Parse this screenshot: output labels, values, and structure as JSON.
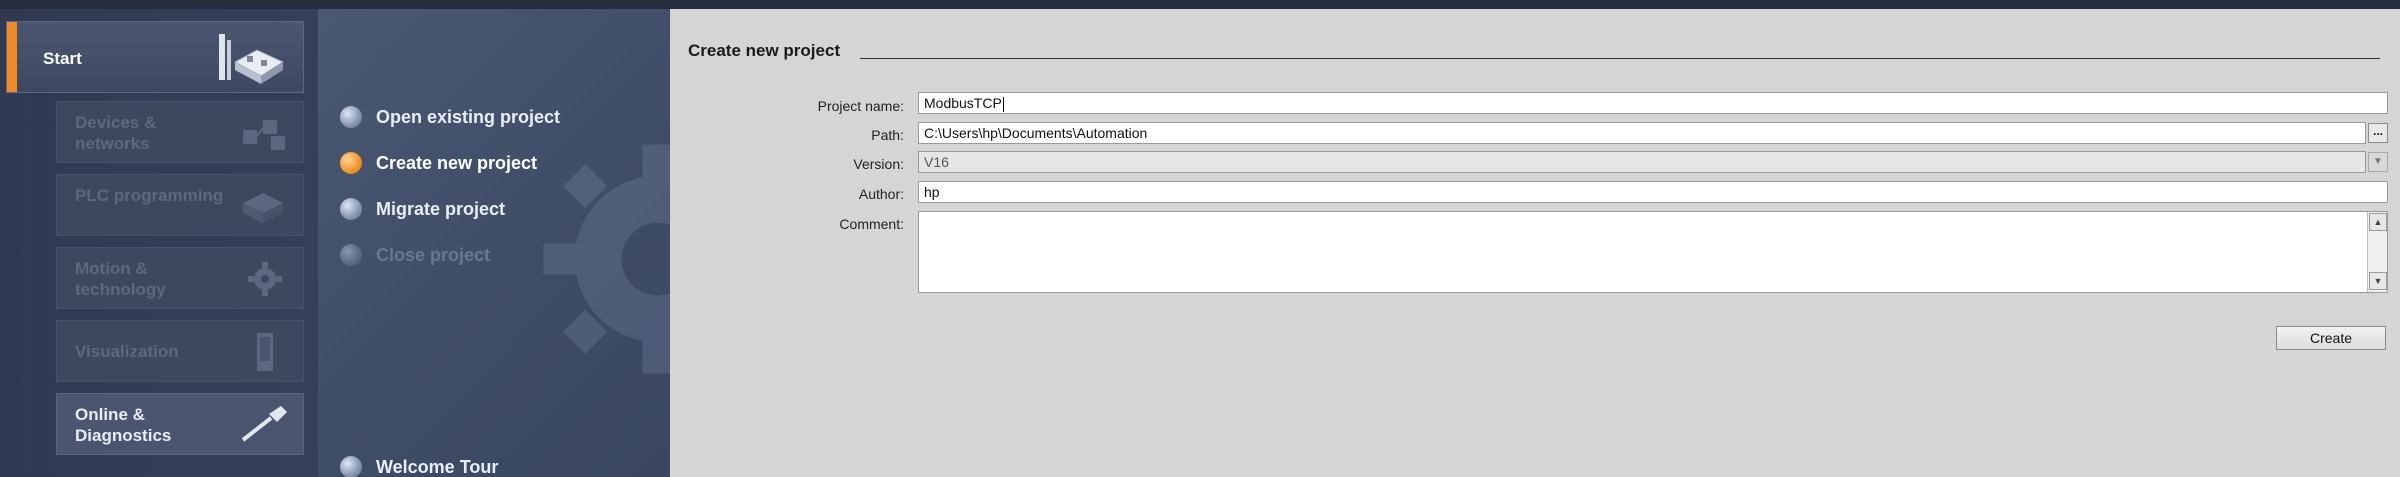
{
  "portal": {
    "start_label": "Start",
    "items": [
      {
        "label": "Devices & networks",
        "enabled": false
      },
      {
        "label": "PLC programming",
        "enabled": false
      },
      {
        "label": "Motion & technology",
        "enabled": false
      },
      {
        "label": "Visualization",
        "enabled": false
      },
      {
        "label": "Online & Diagnostics",
        "enabled": true
      }
    ]
  },
  "actions": [
    {
      "label": "Open existing project",
      "state": "normal"
    },
    {
      "label": "Create new project",
      "state": "active"
    },
    {
      "label": "Migrate project",
      "state": "normal"
    },
    {
      "label": "Close project",
      "state": "disabled"
    },
    {
      "label": "Welcome Tour",
      "state": "normal"
    }
  ],
  "form": {
    "section_title": "Create new project",
    "project_name_label": "Project name:",
    "project_name_value": "ModbusTCP",
    "path_label": "Path:",
    "path_value": "C:\\Users\\hp\\Documents\\Automation",
    "browse_label": "...",
    "version_label": "Version:",
    "version_value": "V16",
    "author_label": "Author:",
    "author_value": "hp",
    "comment_label": "Comment:",
    "comment_value": "",
    "create_label": "Create"
  },
  "colors": {
    "accent": "#f08a22",
    "nav_bg": "#2f3a52",
    "content_bg": "#d5d5d5"
  }
}
